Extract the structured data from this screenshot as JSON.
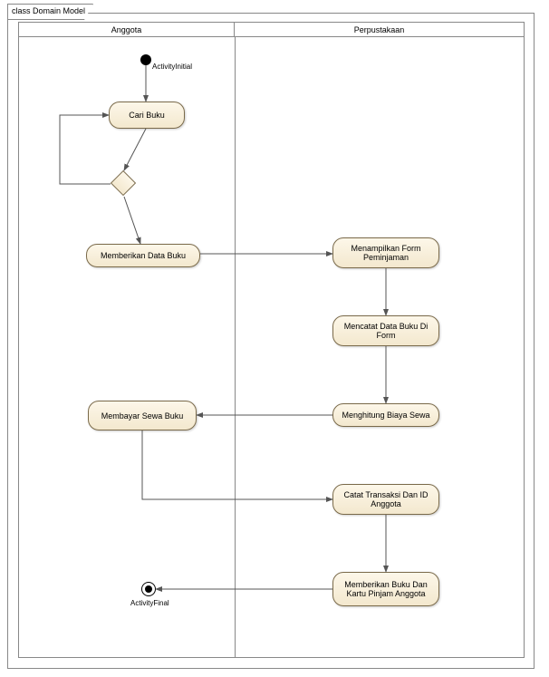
{
  "diagram": {
    "frame_title": "class Domain Model",
    "lanes": {
      "anggota": "Anggota",
      "perpustakaan": "Perpustakaan"
    },
    "nodes": {
      "initial_label": "ActivityInitial",
      "final_label": "ActivityFinal",
      "cari_buku": "Cari Buku",
      "memberikan_data_buku": "Memberikan Data Buku",
      "menampilkan_form": "Menampilkan Form Peminjaman",
      "mencatat_data": "Mencatat Data Buku Di Form",
      "menghitung_biaya": "Menghitung Biaya Sewa",
      "membayar_sewa": "Membayar Sewa Buku",
      "catat_transaksi": "Catat Transaksi Dan ID Anggota",
      "memberikan_buku": "Memberikan Buku Dan Kartu Pinjam Anggota"
    }
  }
}
